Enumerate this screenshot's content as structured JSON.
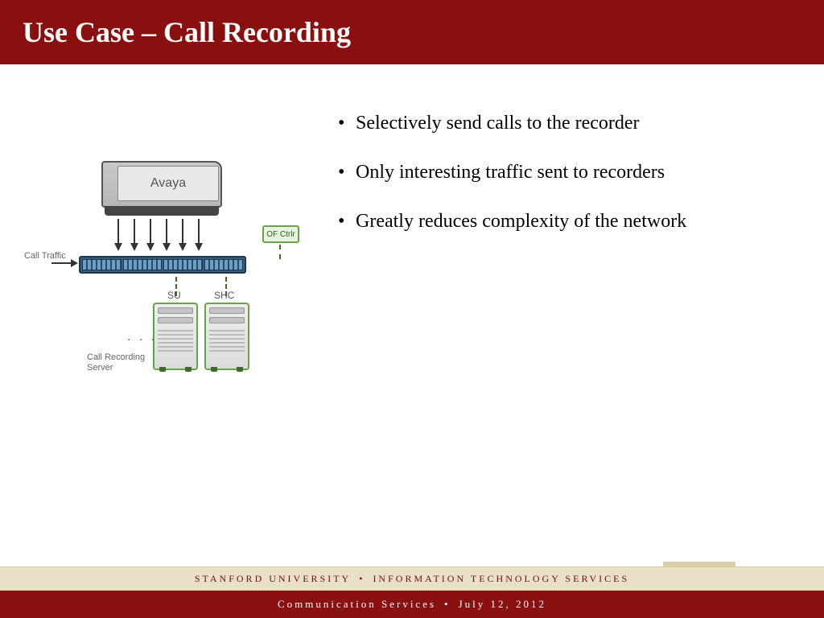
{
  "title": "Use Case – Call Recording",
  "bullets": [
    "Selectively send calls to the recorder",
    "Only interesting traffic sent to recorders",
    "Greatly reduces complexity of the network"
  ],
  "diagram": {
    "avaya_label": "Avaya",
    "ofctrl_label": "OF Ctrlr",
    "call_traffic_label": "Call Traffic",
    "server_su_label": "SU",
    "server_shc_label": "SHC",
    "dots": ". . .",
    "recording_label": "Call Recording Server"
  },
  "footer": {
    "org1": "STANFORD UNIVERSITY",
    "org2": "INFORMATION TECHNOLOGY SERVICES",
    "dept": "Communication Services",
    "date": "July 12, 2012",
    "dot": "•"
  }
}
